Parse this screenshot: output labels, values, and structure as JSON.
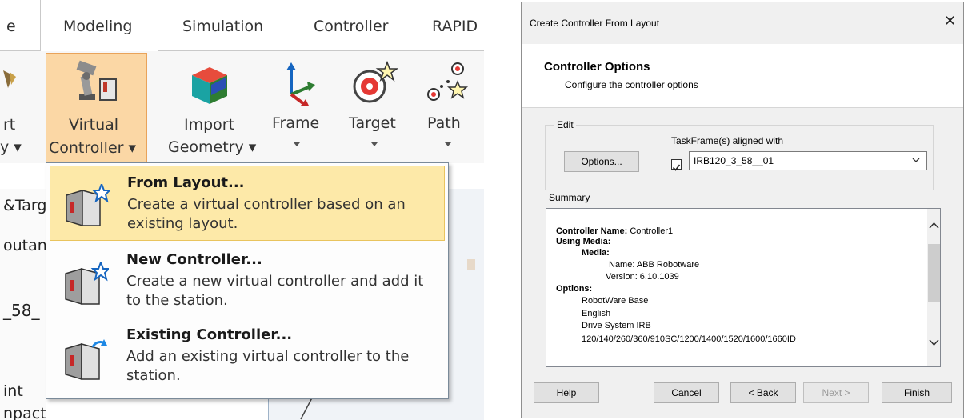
{
  "ribbon": {
    "tabs": [
      {
        "label": "e"
      },
      {
        "label": "Modeling"
      },
      {
        "label": "Simulation"
      },
      {
        "label": "Controller"
      },
      {
        "label": "RAPID"
      }
    ],
    "buttons": {
      "partial_left": {
        "line1": "rt",
        "line2": "y ▾"
      },
      "virtual_controller": {
        "line1": "Virtual",
        "line2": "Controller ▾"
      },
      "import_geometry": {
        "line1": "Import",
        "line2": "Geometry ▾"
      },
      "frame": {
        "label": "Frame"
      },
      "target": {
        "label": "Target"
      },
      "path": {
        "label": "Path"
      }
    },
    "side_fragments": [
      "&Targ",
      "outan",
      "_58_",
      "int",
      "npact"
    ]
  },
  "dropdown": {
    "items": [
      {
        "title": "From Layout...",
        "description": "Create a virtual controller based on an existing layout.",
        "highlighted": true
      },
      {
        "title": "New Controller...",
        "description": "Create a new virtual controller and add it to the station.",
        "highlighted": false
      },
      {
        "title": "Existing Controller...",
        "description": "Add an existing virtual controller to the station.",
        "highlighted": false
      }
    ]
  },
  "dialog": {
    "title": "Create Controller From Layout",
    "close_glyph": "✕",
    "header_title": "Controller Options",
    "header_subtitle": "Configure the controller options",
    "edit_group": {
      "legend": "Edit",
      "options_button": "Options...",
      "taskframe_label": "TaskFrame(s) aligned with",
      "taskframe_checked": true,
      "taskframe_value": "IRB120_3_58__01"
    },
    "summary_label": "Summary",
    "summary": {
      "controller_name_label": "Controller Name:",
      "controller_name_value": "Controller1",
      "using_media_label": "Using Media:",
      "media_label": "Media:",
      "media_name": "Name: ABB Robotware",
      "media_version": "Version: 6.10.1039",
      "options_label": "Options:",
      "options": [
        "RobotWare Base",
        "English",
        "Drive System IRB",
        "120/140/260/360/910SC/1200/1400/1520/1600/1660ID"
      ]
    },
    "footer": {
      "help": "Help",
      "cancel": "Cancel",
      "back": "< Back",
      "next": "Next >",
      "finish": "Finish"
    }
  },
  "colors": {
    "active_button_fill": "#fbd7a5",
    "menu_highlight": "#fde9a8",
    "dialog_bg": "#f0f0f0"
  }
}
